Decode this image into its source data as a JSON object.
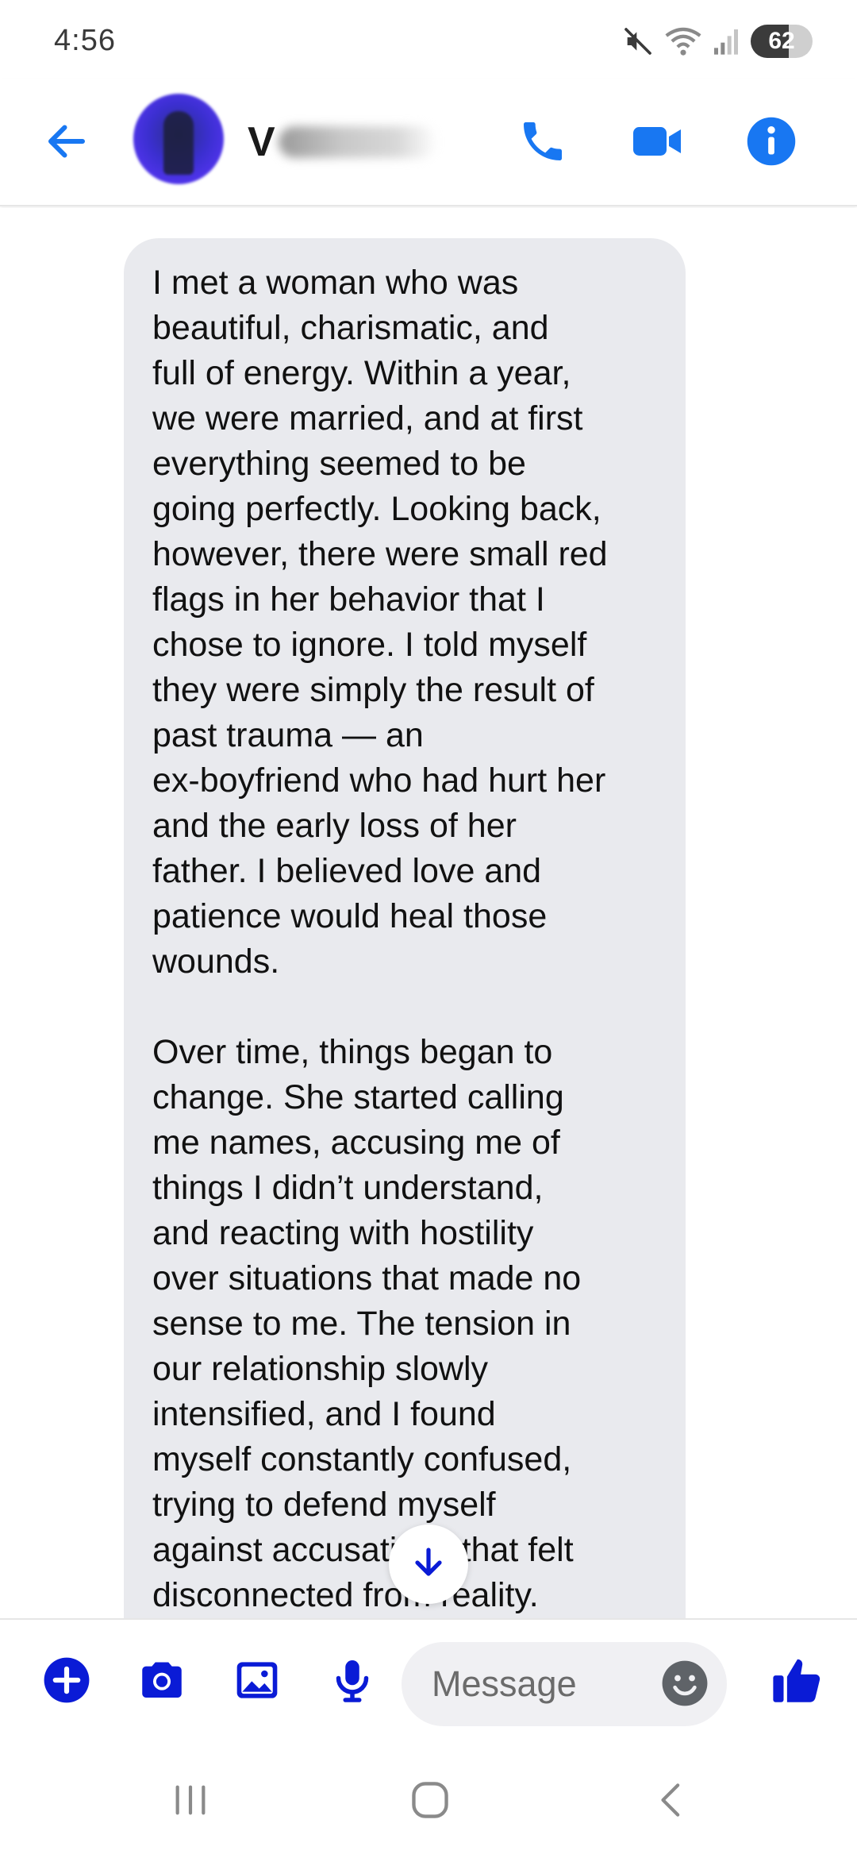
{
  "status_bar": {
    "time": "4:56",
    "battery_level": "62",
    "battery_fraction": 0.62,
    "icons": [
      "mute-icon",
      "wifi-icon",
      "signal-icon",
      "battery-icon"
    ]
  },
  "header": {
    "contact_initial": "V",
    "icons": [
      "back-arrow-icon",
      "phone-icon",
      "video-camera-icon",
      "info-icon"
    ]
  },
  "message": {
    "paragraphs": [
      "I met a woman who was\nbeautiful, charismatic, and\nfull of energy. Within a year,\nwe were married, and at first\neverything seemed to be\ngoing perfectly. Looking back,\nhowever, there were small red\nflags in her behavior that I\nchose to ignore. I told myself\nthey were simply the result of\npast trauma — an\nex-boyfriend who had hurt her\nand the early loss of her\nfather. I believed love and\npatience would heal those\nwounds.",
      "Over time, things began to\nchange. She started calling\nme names, accusing me of\nthings I didn’t understand,\nand reacting with hostility\nover situations that made no\nsense to me. The tension in\nour relationship slowly\nintensified, and I found\nmyself constantly confused,\ntrying to defend myself\nagainst accusations that felt\ndisconnected from reality."
    ]
  },
  "composer": {
    "placeholder": "Message",
    "icons": [
      "plus-icon",
      "camera-icon",
      "gallery-icon",
      "microphone-icon",
      "emoji-icon",
      "thumbs-up-icon"
    ]
  },
  "colors": {
    "accent": "#0a1bd6",
    "header_icon": "#1877f2",
    "bubble_bg": "#e9eaee",
    "text": "#111111"
  }
}
